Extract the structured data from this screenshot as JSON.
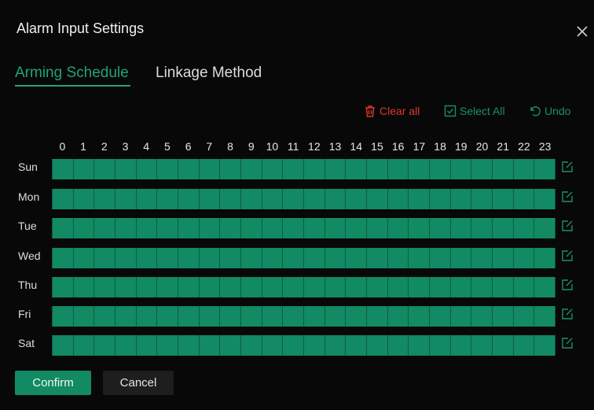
{
  "dialog": {
    "title": "Alarm Input Settings",
    "close_icon": "close-icon"
  },
  "tabs": [
    {
      "label": "Arming Schedule",
      "active": true
    },
    {
      "label": "Linkage Method",
      "active": false
    }
  ],
  "actions": {
    "clear_all": {
      "label": "Clear all",
      "icon": "trash-icon",
      "color": "#e0352f"
    },
    "select_all": {
      "label": "Select All",
      "icon": "checkbox-icon",
      "color": "#189169"
    },
    "undo": {
      "label": "Undo",
      "icon": "undo-icon",
      "color": "#189169"
    }
  },
  "schedule": {
    "hours": [
      "0",
      "1",
      "2",
      "3",
      "4",
      "5",
      "6",
      "7",
      "8",
      "9",
      "10",
      "11",
      "12",
      "13",
      "14",
      "15",
      "16",
      "17",
      "18",
      "19",
      "20",
      "21",
      "22",
      "23"
    ],
    "days": [
      {
        "label": "Sun",
        "armed_hours": 24
      },
      {
        "label": "Mon",
        "armed_hours": 24
      },
      {
        "label": "Tue",
        "armed_hours": 24
      },
      {
        "label": "Wed",
        "armed_hours": 24
      },
      {
        "label": "Thu",
        "armed_hours": 24
      },
      {
        "label": "Fri",
        "armed_hours": 24
      },
      {
        "label": "Sat",
        "armed_hours": 24
      }
    ],
    "armed_color": "#128a63",
    "row_edit_icon": "edit-icon"
  },
  "buttons": {
    "confirm": "Confirm",
    "cancel": "Cancel"
  },
  "colors": {
    "accent": "#1fa37b",
    "background": "#080808"
  }
}
